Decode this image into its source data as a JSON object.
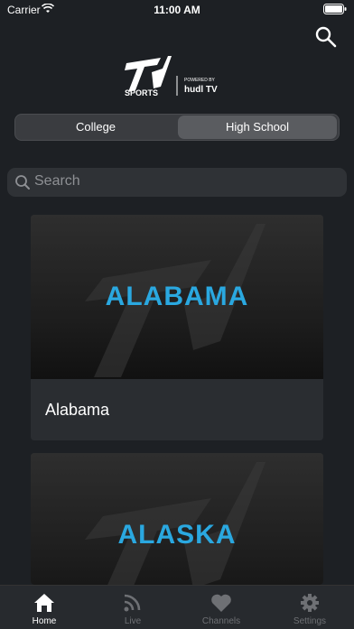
{
  "status_bar": {
    "carrier": "Carrier",
    "time": "11:00 AM"
  },
  "header": {
    "logo_main": "SPORTS",
    "logo_powered": "POWERED BY",
    "logo_partner": "hudl TV"
  },
  "segmented": {
    "options": [
      "College",
      "High School"
    ],
    "selected": "High School"
  },
  "search": {
    "placeholder": "Search"
  },
  "cards": [
    {
      "state": "ALABAMA",
      "label": "Alabama"
    },
    {
      "state": "ALASKA",
      "label": "Alaska"
    }
  ],
  "tabs": [
    {
      "label": "Home",
      "icon": "home-icon",
      "active": true
    },
    {
      "label": "Live",
      "icon": "live-icon",
      "active": false
    },
    {
      "label": "Channels",
      "icon": "heart-icon",
      "active": false
    },
    {
      "label": "Settings",
      "icon": "gear-icon",
      "active": false
    }
  ],
  "colors": {
    "background": "#1d2024",
    "accent_blue": "#2aa8e0",
    "segment_selected": "#5a5c60"
  }
}
